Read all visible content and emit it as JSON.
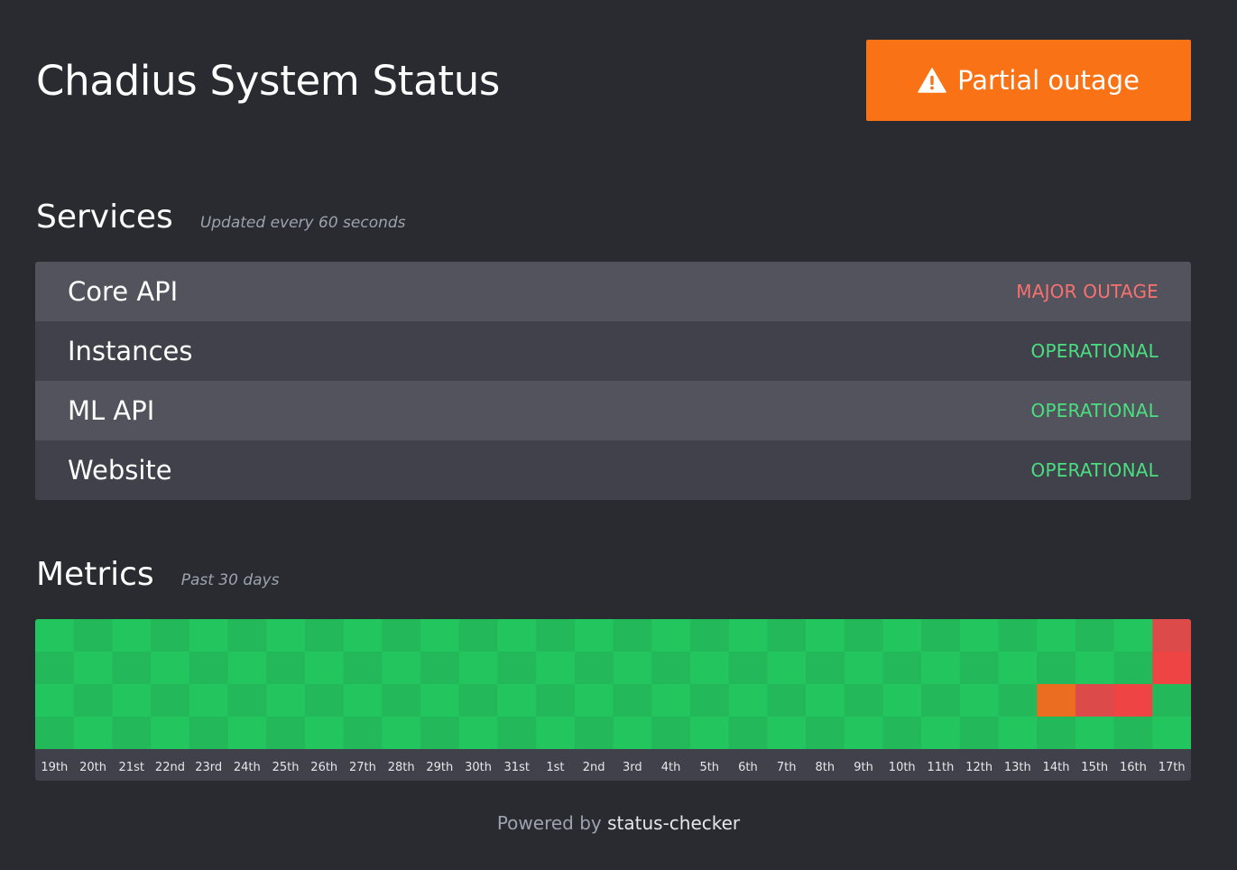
{
  "header": {
    "title": "Chadius System Status",
    "banner": {
      "label": "Partial outage",
      "icon": "warning-icon",
      "color": "#f97316"
    }
  },
  "services": {
    "title": "Services",
    "subtitle": "Updated every 60 seconds",
    "items": [
      {
        "name": "Core API",
        "status": "MAJOR OUTAGE",
        "status_color": "#f87171"
      },
      {
        "name": "Instances",
        "status": "OPERATIONAL",
        "status_color": "#4ade80"
      },
      {
        "name": "ML API",
        "status": "OPERATIONAL",
        "status_color": "#4ade80"
      },
      {
        "name": "Website",
        "status": "OPERATIONAL",
        "status_color": "#4ade80"
      }
    ]
  },
  "metrics": {
    "title": "Metrics",
    "subtitle": "Past 30 days",
    "days": [
      "19th",
      "20th",
      "21st",
      "22nd",
      "23rd",
      "24th",
      "25th",
      "26th",
      "27th",
      "28th",
      "29th",
      "30th",
      "31st",
      "1st",
      "2nd",
      "3rd",
      "4th",
      "5th",
      "6th",
      "7th",
      "8th",
      "9th",
      "10th",
      "11th",
      "12th",
      "13th",
      "14th",
      "15th",
      "16th",
      "17th"
    ],
    "rows": [
      {
        "service": "Core API",
        "states": [
          "ok",
          "ok",
          "ok",
          "ok",
          "ok",
          "ok",
          "ok",
          "ok",
          "ok",
          "ok",
          "ok",
          "ok",
          "ok",
          "ok",
          "ok",
          "ok",
          "ok",
          "ok",
          "ok",
          "ok",
          "ok",
          "ok",
          "ok",
          "ok",
          "ok",
          "ok",
          "ok",
          "ok",
          "ok",
          "major"
        ]
      },
      {
        "service": "Instances",
        "states": [
          "ok",
          "ok",
          "ok",
          "ok",
          "ok",
          "ok",
          "ok",
          "ok",
          "ok",
          "ok",
          "ok",
          "ok",
          "ok",
          "ok",
          "ok",
          "ok",
          "ok",
          "ok",
          "ok",
          "ok",
          "ok",
          "ok",
          "ok",
          "ok",
          "ok",
          "ok",
          "ok",
          "ok",
          "ok",
          "major"
        ]
      },
      {
        "service": "ML API",
        "states": [
          "ok",
          "ok",
          "ok",
          "ok",
          "ok",
          "ok",
          "ok",
          "ok",
          "ok",
          "ok",
          "ok",
          "ok",
          "ok",
          "ok",
          "ok",
          "ok",
          "ok",
          "ok",
          "ok",
          "ok",
          "ok",
          "ok",
          "ok",
          "ok",
          "ok",
          "ok",
          "partial",
          "major",
          "major",
          "ok"
        ]
      },
      {
        "service": "Website",
        "states": [
          "ok",
          "ok",
          "ok",
          "ok",
          "ok",
          "ok",
          "ok",
          "ok",
          "ok",
          "ok",
          "ok",
          "ok",
          "ok",
          "ok",
          "ok",
          "ok",
          "ok",
          "ok",
          "ok",
          "ok",
          "ok",
          "ok",
          "ok",
          "ok",
          "ok",
          "ok",
          "ok",
          "ok",
          "ok",
          "ok"
        ]
      }
    ],
    "colors": {
      "ok_light": "#22c55e",
      "ok_dark": "#23b85a",
      "partial": "#ea6d22",
      "major_light": "#ef4444",
      "major_dark": "#dc4a4a",
      "label": "#e5e7eb"
    }
  },
  "footer": {
    "prefix": "Powered by",
    "brand": "status-checker"
  }
}
